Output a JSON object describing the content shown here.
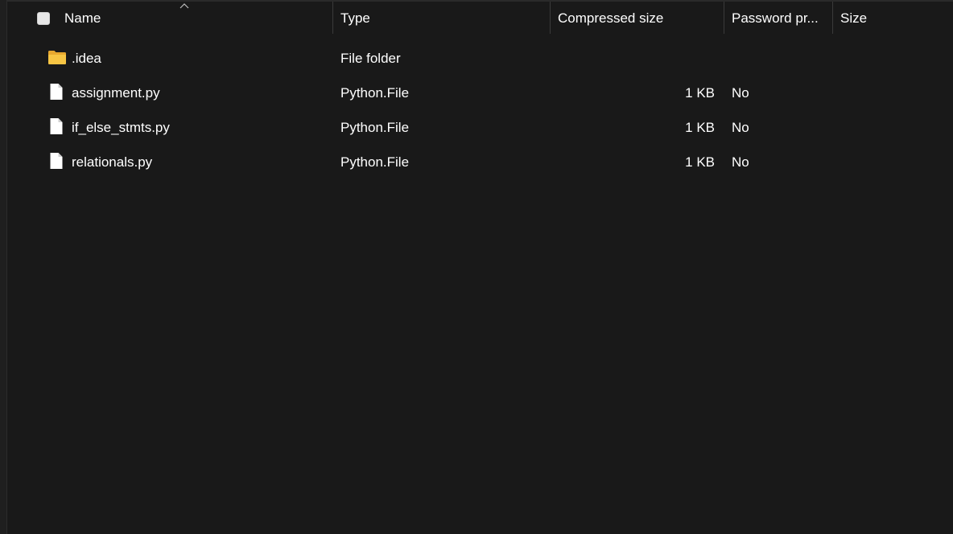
{
  "header": {
    "select_all_checked": false,
    "columns": {
      "name": "Name",
      "type": "Type",
      "compressed_size": "Compressed size",
      "password_protected": "Password pr...",
      "size": "Size"
    },
    "sort_column": "name",
    "sort_direction": "ascending"
  },
  "rows": [
    {
      "icon": "folder-icon",
      "name": ".idea",
      "type": "File folder",
      "compressed_size": "",
      "password_protected": "",
      "size": ""
    },
    {
      "icon": "file-icon",
      "name": "assignment.py",
      "type": "Python.File",
      "compressed_size": "1 KB",
      "password_protected": "No",
      "size": ""
    },
    {
      "icon": "file-icon",
      "name": "if_else_stmts.py",
      "type": "Python.File",
      "compressed_size": "1 KB",
      "password_protected": "No",
      "size": ""
    },
    {
      "icon": "file-icon",
      "name": "relationals.py",
      "type": "Python.File",
      "compressed_size": "1 KB",
      "password_protected": "No",
      "size": ""
    }
  ],
  "colors": {
    "background": "#191919",
    "text": "#ffffff",
    "folder_yellow": "#f7c544",
    "file_white": "#ffffff",
    "separator": "#3a3a3a"
  }
}
